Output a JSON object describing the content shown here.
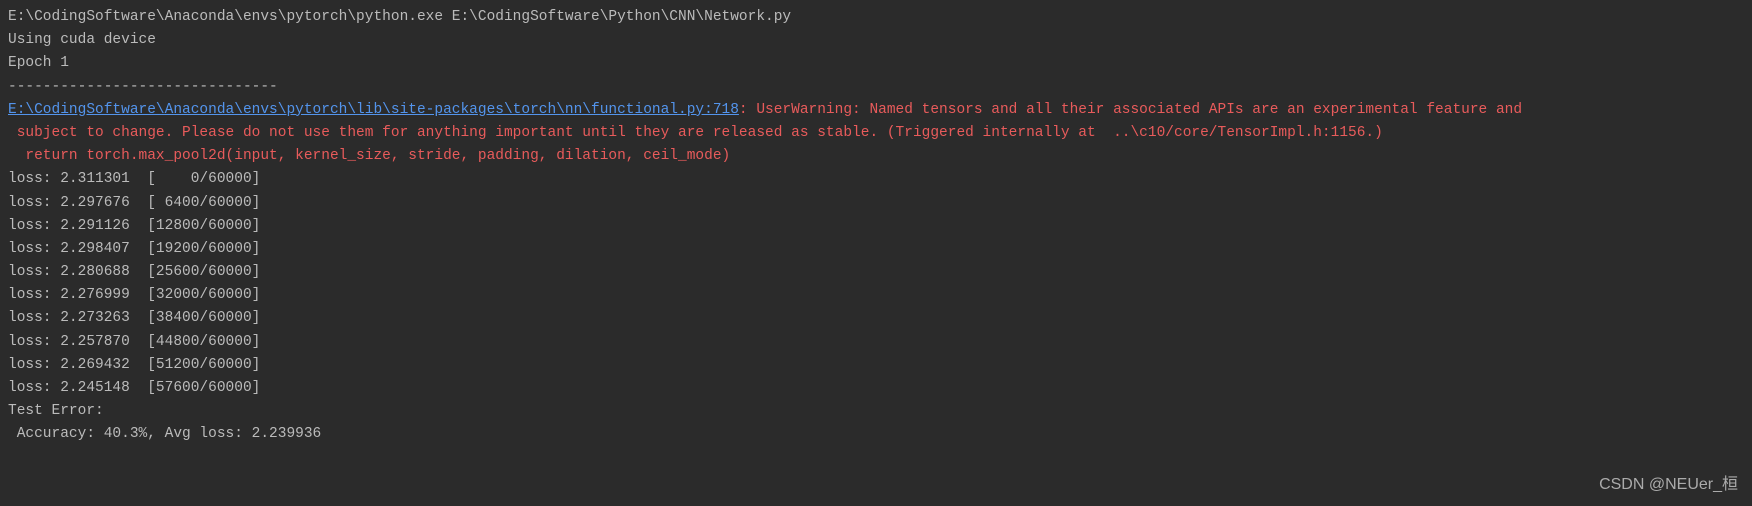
{
  "command_line": "E:\\CodingSoftware\\Anaconda\\envs\\pytorch\\python.exe E:\\CodingSoftware\\Python\\CNN\\Network.py",
  "device_line": "Using cuda device",
  "epoch_line": "Epoch 1",
  "divider": "-------------------------------",
  "warning": {
    "path": "E:\\CodingSoftware\\Anaconda\\envs\\pytorch\\lib\\site-packages\\torch\\nn\\functional.py:718",
    "line1_suffix": ": UserWarning: Named tensors and all their associated APIs are an experimental feature and",
    "line2": " subject to change. Please do not use them for anything important until they are released as stable. (Triggered internally at  ..\\c10/core/TensorImpl.h:1156.)",
    "line3": "  return torch.max_pool2d(input, kernel_size, stride, padding, dilation, ceil_mode)"
  },
  "losses": [
    {
      "value": "2.311301",
      "progress": "[    0/60000]"
    },
    {
      "value": "2.297676",
      "progress": "[ 6400/60000]"
    },
    {
      "value": "2.291126",
      "progress": "[12800/60000]"
    },
    {
      "value": "2.298407",
      "progress": "[19200/60000]"
    },
    {
      "value": "2.280688",
      "progress": "[25600/60000]"
    },
    {
      "value": "2.276999",
      "progress": "[32000/60000]"
    },
    {
      "value": "2.273263",
      "progress": "[38400/60000]"
    },
    {
      "value": "2.257870",
      "progress": "[44800/60000]"
    },
    {
      "value": "2.269432",
      "progress": "[51200/60000]"
    },
    {
      "value": "2.245148",
      "progress": "[57600/60000]"
    }
  ],
  "loss_prefix": "loss: ",
  "loss_separator": "  ",
  "test_error": {
    "header": "Test Error: ",
    "result": " Accuracy: 40.3%, Avg loss: 2.239936 "
  },
  "watermark": "CSDN @NEUer_桓"
}
